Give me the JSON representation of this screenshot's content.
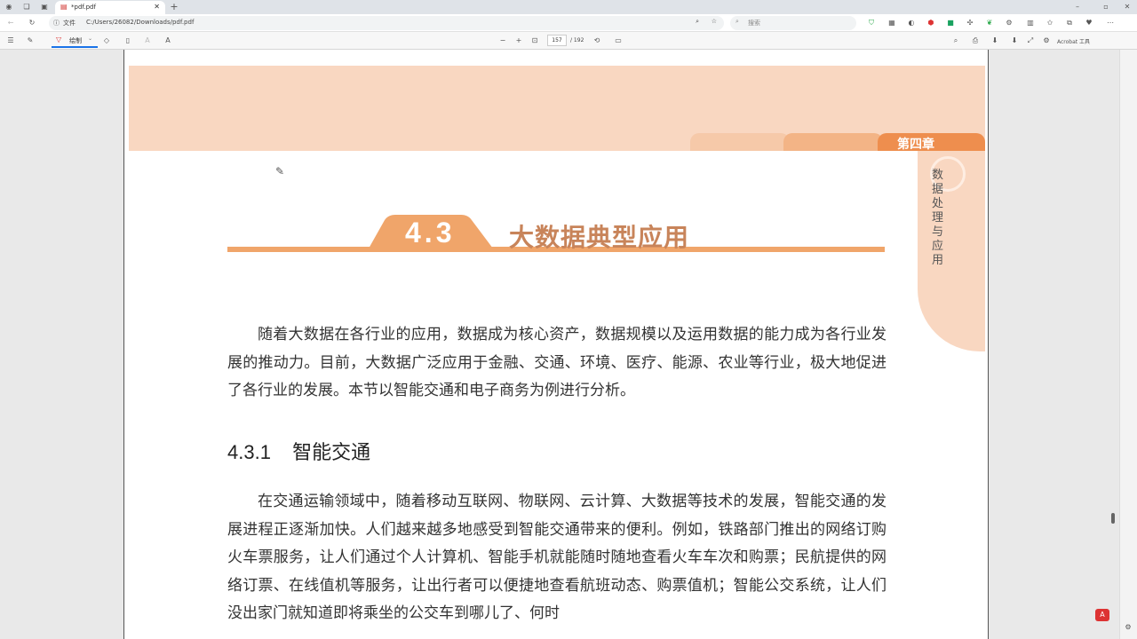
{
  "browser": {
    "tab_title": "*pdf.pdf",
    "address_label": "文件",
    "url": "C:/Users/26082/Downloads/pdf.pdf",
    "search_placeholder": "搜索",
    "overlay_text": "Acrobat 工具"
  },
  "pdf_toolbar": {
    "draw_label": "绘制",
    "current_page": "157",
    "total_pages": "/ 192"
  },
  "page": {
    "chapter_label": "第四章",
    "side_title": "数据处理与应用",
    "section_number": "4.3",
    "section_title": "大数据典型应用",
    "intro_paragraph": "随着大数据在各行业的应用，数据成为核心资产，数据规模以及运用数据的能力成为各行业发展的推动力。目前，大数据广泛应用于金融、交通、环境、医疗、能源、农业等行业，极大地促进了各行业的发展。本节以智能交通和电子商务为例进行分析。",
    "subsection_number": "4.3.1",
    "subsection_title": "智能交通",
    "body_paragraph": "在交通运输领域中，随着移动互联网、物联网、云计算、大数据等技术的发展，智能交通的发展进程正逐渐加快。人们越来越多地感受到智能交通带来的便利。例如，铁路部门推出的网络订购火车票服务，让人们通过个人计算机、智能手机就能随时随地查看火车车次和购票；民航提供的网络订票、在线值机等服务，让出行者可以便捷地查看航班动态、购票值机；智能公交系统，让人们没出家门就知道即将乘坐的公交车到哪儿了、何时"
  },
  "colors": {
    "accent_orange": "#f0a56a",
    "band_peach": "#f9d7c1",
    "chapter_tab_dark": "#ee8e4e",
    "title_brown": "#c8845a"
  }
}
